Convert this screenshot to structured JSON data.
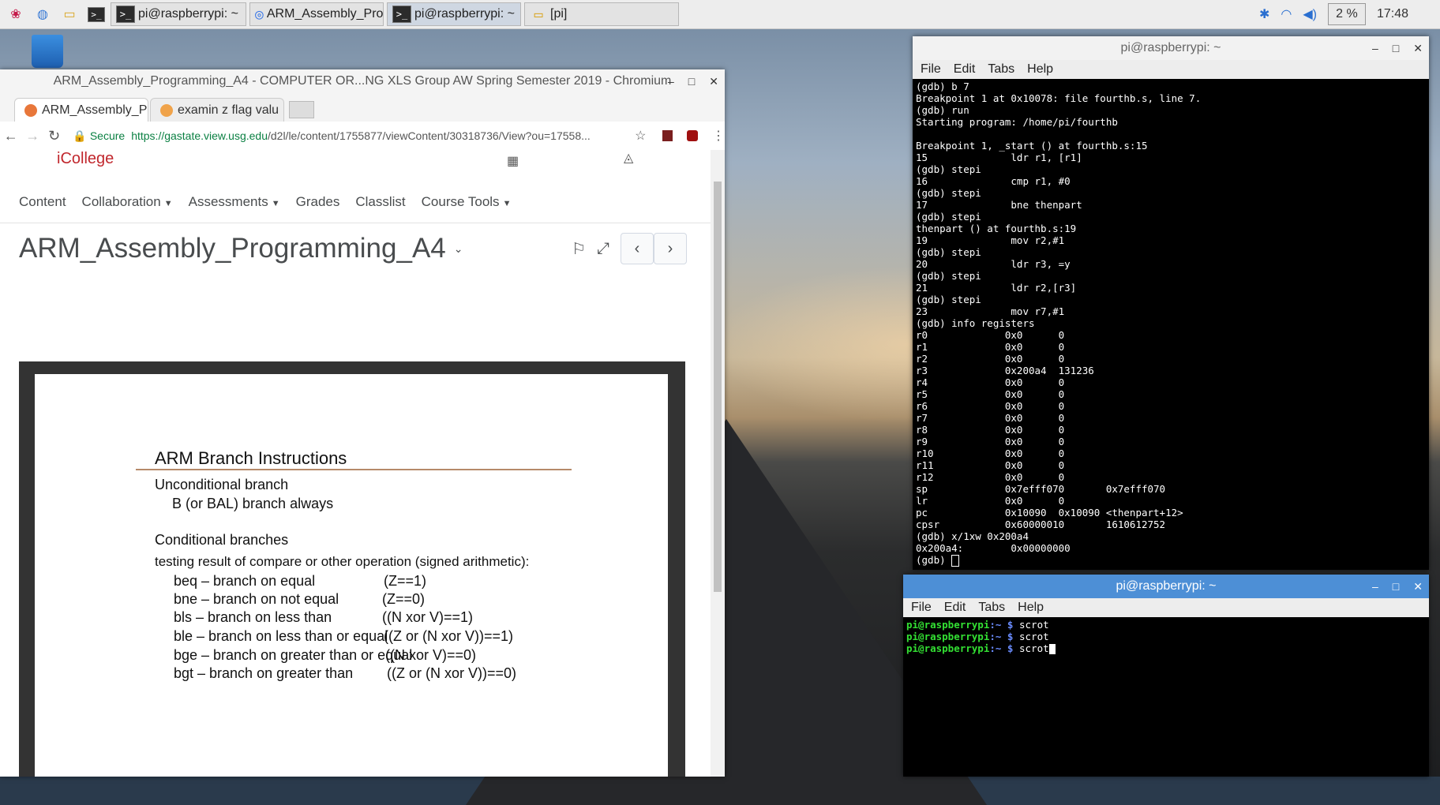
{
  "taskbar": {
    "tasks": [
      {
        "label": "pi@raspberrypi: ~",
        "icon": "terminal-icon"
      },
      {
        "label": "ARM_Assembly_Prog...",
        "icon": "chromium-icon"
      },
      {
        "label": "pi@raspberrypi: ~",
        "icon": "terminal-icon"
      },
      {
        "label": "[pi]",
        "icon": "folder-icon"
      }
    ],
    "cpu": "2 %",
    "clock": "17:48"
  },
  "browser": {
    "title": "ARM_Assembly_Programming_A4 - COMPUTER OR...NG XLS Group AW Spring Semester 2019 - Chromium",
    "tabs": [
      {
        "label": "ARM_Assembly_P"
      },
      {
        "label": "examin z flag valu"
      }
    ],
    "secure": "Secure",
    "url_host": "https://gastate.view.usg.edu",
    "url_rest": "/d2l/le/content/1755877/viewContent/30318736/View?ou=17558...",
    "nav": [
      "Content",
      "Collaboration",
      "Assessments",
      "Grades",
      "Classlist",
      "Course Tools"
    ],
    "logo": "iCollege",
    "heading": "ARM_Assembly_Programming_A4"
  },
  "document": {
    "title": "ARM Branch Instructions",
    "uncond_header": "Unconditional branch",
    "uncond_item": "B (or BAL)  branch always",
    "cond_header": "Conditional branches",
    "cond_intro": "testing result of compare or other operation (signed arithmetic):",
    "conditions": [
      {
        "name": "beq – branch on equal",
        "flag": "(Z==1)"
      },
      {
        "name": "bne – branch on not equal",
        "flag": "(Z==0)"
      },
      {
        "name": "bls  – branch on less than",
        "flag": "((N xor V)==1)"
      },
      {
        "name": "ble  – branch on less than or equal",
        "flag": "((Z or (N xor V))==1)"
      },
      {
        "name": "bge – branch on greater than or equal",
        "flag": "((N xor V)==0)"
      },
      {
        "name": "bgt – branch on greater than",
        "flag": "((Z or (N xor V))==0)"
      }
    ]
  },
  "terminal1": {
    "title": "pi@raspberrypi: ~",
    "menu": [
      "File",
      "Edit",
      "Tabs",
      "Help"
    ],
    "output": "(gdb) b 7\nBreakpoint 1 at 0x10078: file fourthb.s, line 7.\n(gdb) run\nStarting program: /home/pi/fourthb\n\nBreakpoint 1, _start () at fourthb.s:15\n15              ldr r1, [r1]\n(gdb) stepi\n16              cmp r1, #0\n(gdb) stepi\n17              bne thenpart\n(gdb) stepi\nthenpart () at fourthb.s:19\n19              mov r2,#1\n(gdb) stepi\n20              ldr r3, =y\n(gdb) stepi\n21              ldr r2,[r3]\n(gdb) stepi\n23              mov r7,#1\n(gdb) info registers\nr0             0x0      0\nr1             0x0      0\nr2             0x0      0\nr3             0x200a4  131236\nr4             0x0      0\nr5             0x0      0\nr6             0x0      0\nr7             0x0      0\nr8             0x0      0\nr9             0x0      0\nr10            0x0      0\nr11            0x0      0\nr12            0x0      0\nsp             0x7efff070       0x7efff070\nlr             0x0      0\npc             0x10090  0x10090 <thenpart+12>\ncpsr           0x60000010       1610612752\n(gdb) x/1xw 0x200a4\n0x200a4:        0x00000000\n(gdb) "
  },
  "terminal2": {
    "title": "pi@raspberrypi: ~",
    "menu": [
      "File",
      "Edit",
      "Tabs",
      "Help"
    ],
    "user": "pi@raspberrypi",
    "path": ":~ $ ",
    "commands": [
      "scrot",
      "scrot",
      "scrot"
    ]
  }
}
